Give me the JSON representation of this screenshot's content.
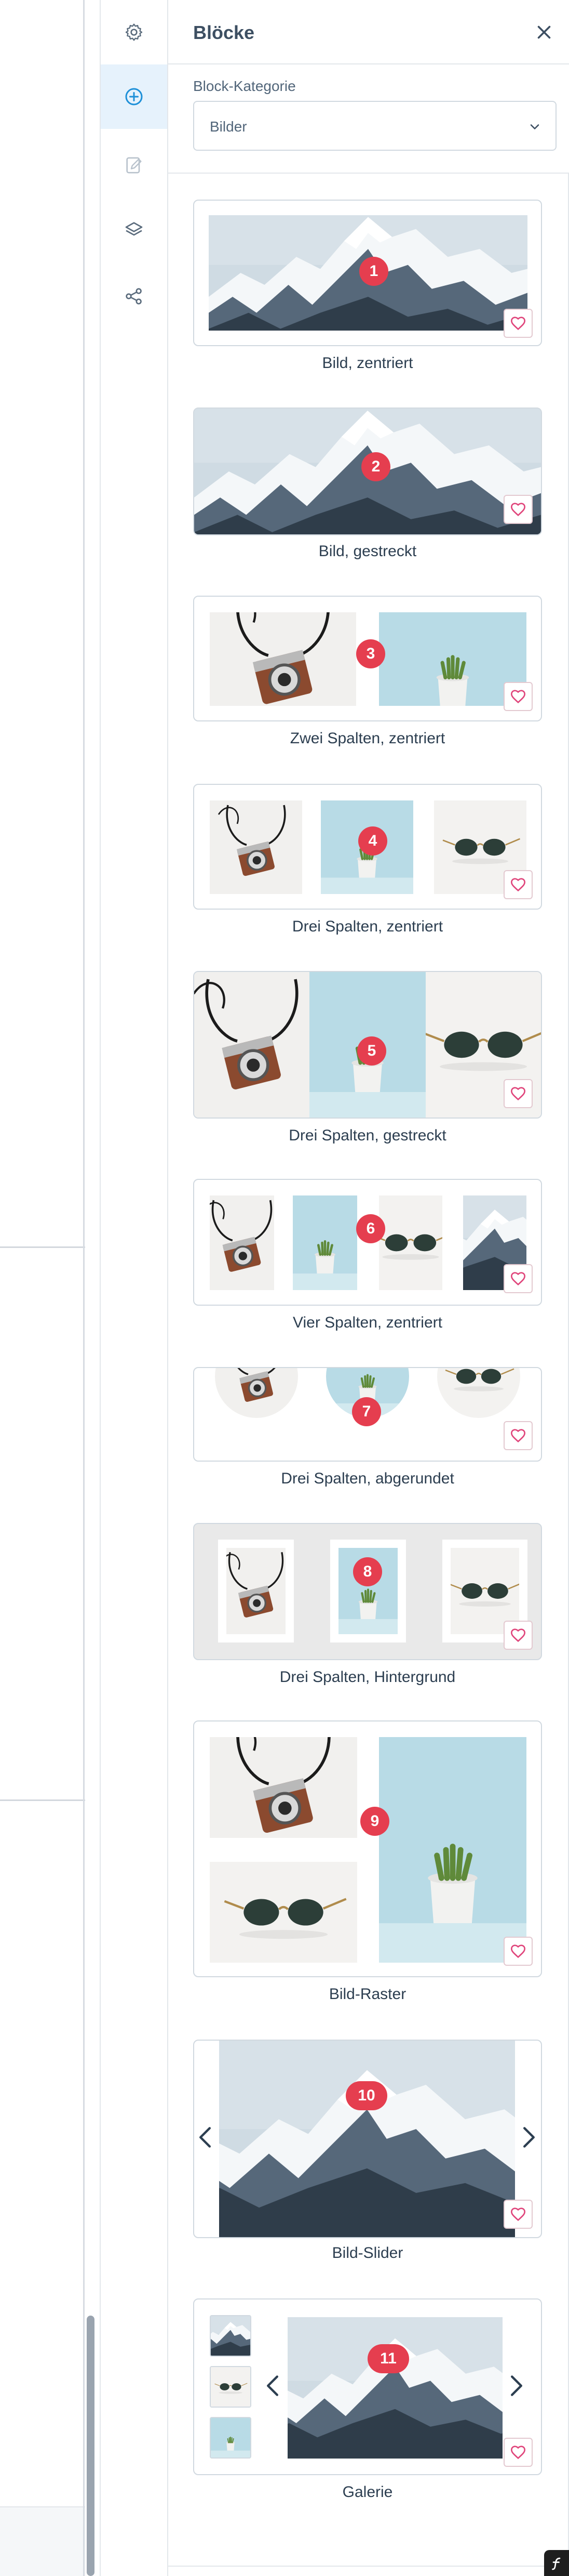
{
  "panel": {
    "title": "Blöcke",
    "close_icon": "close-icon",
    "category_label": "Block-Kategorie",
    "category_value": "Bilder",
    "category_chevron_icon": "chevron-down-icon"
  },
  "rail": {
    "items": [
      {
        "icon": "gear-icon",
        "active": false
      },
      {
        "icon": "add-circle-icon",
        "active": true
      },
      {
        "icon": "edit-document-icon",
        "active": false
      },
      {
        "icon": "layers-icon",
        "active": false
      },
      {
        "icon": "share-icon",
        "active": false
      }
    ]
  },
  "blocks": [
    {
      "number": "1",
      "label": "Bild, zentriert"
    },
    {
      "number": "2",
      "label": "Bild, gestreckt"
    },
    {
      "number": "3",
      "label": "Zwei Spalten, zentriert"
    },
    {
      "number": "4",
      "label": "Drei Spalten, zentriert"
    },
    {
      "number": "5",
      "label": "Drei Spalten, gestreckt"
    },
    {
      "number": "6",
      "label": "Vier Spalten, zentriert"
    },
    {
      "number": "7",
      "label": "Drei Spalten, abgerundet"
    },
    {
      "number": "8",
      "label": "Drei Spalten, Hintergrund"
    },
    {
      "number": "9",
      "label": "Bild-Raster"
    },
    {
      "number": "10",
      "label": "Bild-Slider"
    },
    {
      "number": "11",
      "label": "Galerie"
    }
  ],
  "icons": {
    "favorite": "heart-icon",
    "slider_prev": "chevron-left-icon",
    "slider_next": "chevron-right-icon",
    "symfony": "symfony-logo-icon"
  },
  "colors": {
    "accent": "#1e90d8",
    "badge": "#e53e4f",
    "favorite": "#e0457b",
    "rail_active_bg": "#e6f2fc"
  }
}
